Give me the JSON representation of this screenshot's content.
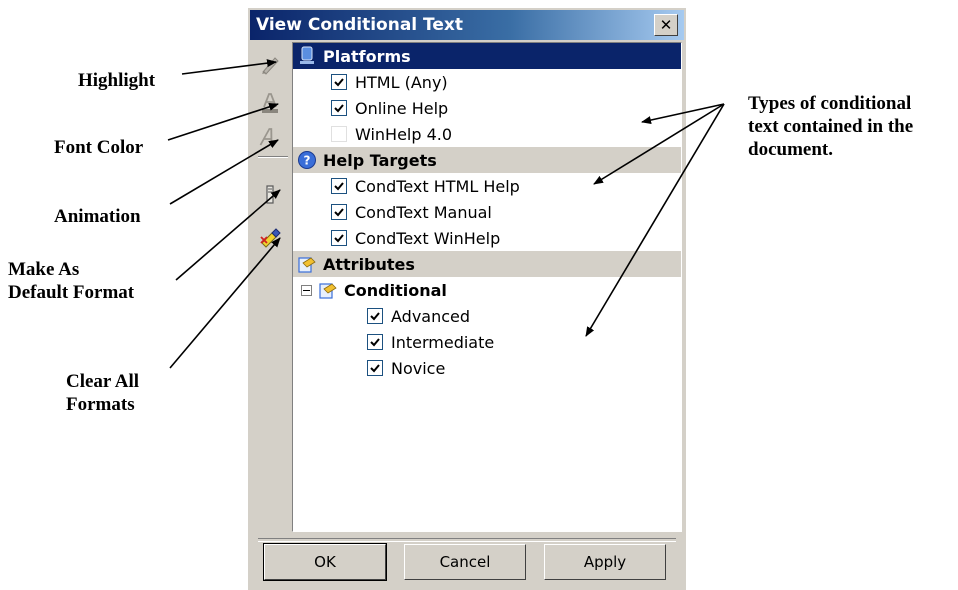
{
  "dialog": {
    "title": "View Conditional Text",
    "close_label": "✕",
    "buttons": {
      "ok": "OK",
      "cancel": "Cancel",
      "apply": "Apply"
    }
  },
  "toolbar": {
    "tools": [
      "highlight-icon",
      "font-color-icon",
      "animation-icon",
      "make-default-format-icon",
      "clear-all-formats-icon"
    ]
  },
  "groups": {
    "platforms": {
      "label": "Platforms",
      "icon": "platforms-icon",
      "items": [
        {
          "label": "HTML (Any)",
          "checked": true
        },
        {
          "label": "Online Help",
          "checked": true
        },
        {
          "label": "WinHelp 4.0",
          "checked": false
        }
      ]
    },
    "help_targets": {
      "label": "Help Targets",
      "icon": "help-icon",
      "items": [
        {
          "label": "CondText HTML Help",
          "checked": true
        },
        {
          "label": "CondText Manual",
          "checked": true
        },
        {
          "label": "CondText WinHelp",
          "checked": true
        }
      ]
    },
    "attributes": {
      "label": "Attributes",
      "icon": "attributes-icon",
      "subgroup": {
        "label": "Conditional",
        "items": [
          {
            "label": "Advanced",
            "checked": true
          },
          {
            "label": "Intermediate",
            "checked": true
          },
          {
            "label": "Novice",
            "checked": true
          }
        ]
      }
    }
  },
  "callouts": {
    "highlight": "Highlight",
    "font_color": "Font Color",
    "animation": "Animation",
    "make_default_line1": "Make As",
    "make_default_line2": "Default Format",
    "clear_all_line1": "Clear All",
    "clear_all_line2": "Formats",
    "types_line1": "Types of conditional",
    "types_line2": "text contained in the",
    "types_line3": "document."
  },
  "colors": {
    "title_bar": "#0a246a",
    "dialog_face": "#d4d0c8",
    "checkbox_border": "#1c5180"
  }
}
